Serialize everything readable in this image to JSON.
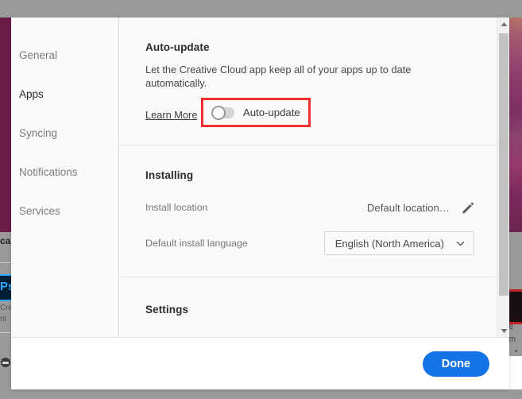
{
  "background": {
    "left_text_fragment_1": "ca",
    "left_app_icon": "Ps",
    "left_text_fragment_2": "Cre",
    "left_text_fragment_3": "nt",
    "right_text_fragment_1": "e",
    "right_text_fragment_2": "m"
  },
  "sidebar": {
    "items": [
      {
        "label": "General",
        "active": false
      },
      {
        "label": "Apps",
        "active": true
      },
      {
        "label": "Syncing",
        "active": false
      },
      {
        "label": "Notifications",
        "active": false
      },
      {
        "label": "Services",
        "active": false
      }
    ]
  },
  "sections": {
    "auto_update": {
      "title": "Auto-update",
      "description": "Let the Creative Cloud app keep all of your apps up to date automatically.",
      "learn_more": "Learn More",
      "toggle_label": "Auto-update",
      "toggle_state": "off",
      "highlight_color": "#f42d2d"
    },
    "installing": {
      "title": "Installing",
      "rows": [
        {
          "label": "Install location",
          "value": "Default location…",
          "control": "pencil-icon"
        },
        {
          "label": "Default install language",
          "value": "English (North America)",
          "control": "select"
        }
      ]
    },
    "settings": {
      "title": "Settings"
    }
  },
  "footer": {
    "done_label": "Done",
    "accent_color": "#1473e6"
  },
  "scrollbar": {
    "up_arrow": "scroll-up-arrow",
    "down_arrow": "scroll-down-arrow"
  }
}
